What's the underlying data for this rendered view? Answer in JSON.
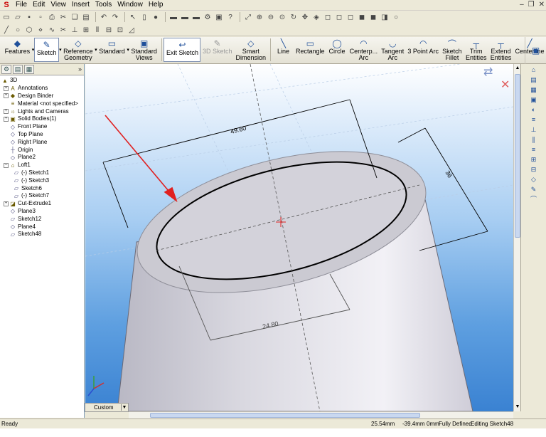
{
  "menu": {
    "items": [
      "File",
      "Edit",
      "View",
      "Insert",
      "Tools",
      "Window",
      "Help"
    ]
  },
  "command_manager": {
    "items": [
      {
        "label": "Features",
        "icon": "features-icon",
        "dropdown": true
      },
      {
        "label": "Sketch",
        "icon": "sketch-icon",
        "dropdown": true
      },
      {
        "label": "Reference\nGeometry",
        "icon": "reference-geometry-icon",
        "dropdown": true
      },
      {
        "label": "Standard",
        "icon": "standard-icon",
        "dropdown": true
      },
      {
        "label": "Standard\nViews",
        "icon": "standard-views-icon",
        "dropdown": false
      },
      {
        "label": "Exit Sketch",
        "icon": "exit-sketch-icon",
        "dropdown": false
      },
      {
        "label": "3D Sketch",
        "icon": "3d-sketch-icon",
        "dropdown": false
      },
      {
        "label": "Smart\nDimension",
        "icon": "smart-dimension-icon",
        "dropdown": false
      },
      {
        "label": "Line",
        "icon": "line-icon",
        "dropdown": false
      },
      {
        "label": "Rectangle",
        "icon": "rectangle-icon",
        "dropdown": false
      },
      {
        "label": "Circle",
        "icon": "circle-icon",
        "dropdown": false
      },
      {
        "label": "Centerp...\nArc",
        "icon": "centerpoint-arc-icon",
        "dropdown": false
      },
      {
        "label": "Tangent\nArc",
        "icon": "tangent-arc-icon",
        "dropdown": false
      },
      {
        "label": "3 Point Arc",
        "icon": "3-point-arc-icon",
        "dropdown": false
      },
      {
        "label": "Sketch\nFillet",
        "icon": "sketch-fillet-icon",
        "dropdown": false
      },
      {
        "label": "Trim\nEntities",
        "icon": "trim-entities-icon",
        "dropdown": false
      },
      {
        "label": "Extend\nEntities",
        "icon": "extend-entities-icon",
        "dropdown": false
      },
      {
        "label": "Centerline",
        "icon": "centerline-icon",
        "dropdown": false
      }
    ]
  },
  "feature_tree": {
    "root": "3D",
    "items": [
      {
        "label": "Annotations",
        "level": 1,
        "expandable": true
      },
      {
        "label": "Design Binder",
        "level": 1,
        "expandable": true
      },
      {
        "label": "Material <not specified>",
        "level": 1,
        "expandable": false
      },
      {
        "label": "Lights and Cameras",
        "level": 1,
        "expandable": true
      },
      {
        "label": "Solid Bodies(1)",
        "level": 1,
        "expandable": true
      },
      {
        "label": "Front Plane",
        "level": 1,
        "expandable": false
      },
      {
        "label": "Top Plane",
        "level": 1,
        "expandable": false
      },
      {
        "label": "Right Plane",
        "level": 1,
        "expandable": false
      },
      {
        "label": "Origin",
        "level": 1,
        "expandable": false
      },
      {
        "label": "Plane2",
        "level": 1,
        "expandable": false
      },
      {
        "label": "Loft1",
        "level": 1,
        "expandable": true
      },
      {
        "label": "(-) Sketch1",
        "level": 2,
        "expandable": false
      },
      {
        "label": "(-) Sketch3",
        "level": 2,
        "expandable": false
      },
      {
        "label": "Sketch6",
        "level": 2,
        "expandable": false
      },
      {
        "label": "(-) Sketch7",
        "level": 2,
        "expandable": false
      },
      {
        "label": "Cut-Extrude1",
        "level": 1,
        "expandable": true
      },
      {
        "label": "Plane3",
        "level": 1,
        "expandable": false
      },
      {
        "label": "Sketch12",
        "level": 1,
        "expandable": false
      },
      {
        "label": "Plane4",
        "level": 1,
        "expandable": false
      },
      {
        "label": "Sketch48",
        "level": 1,
        "expandable": false
      }
    ],
    "config_select": "Custom"
  },
  "viewport": {
    "dimensions": {
      "top": "49.60",
      "right": "36",
      "bottom": "24.80"
    },
    "colors": {
      "sketch_line": "#000000",
      "arrow": "#e02020",
      "body": "#d4d3dc"
    }
  },
  "status": {
    "left": "Ready",
    "x": "25.54mm",
    "y": "-39.4mm",
    "z": "0mm",
    "state": "Fully Defined",
    "editing": "Editing Sketch48"
  }
}
